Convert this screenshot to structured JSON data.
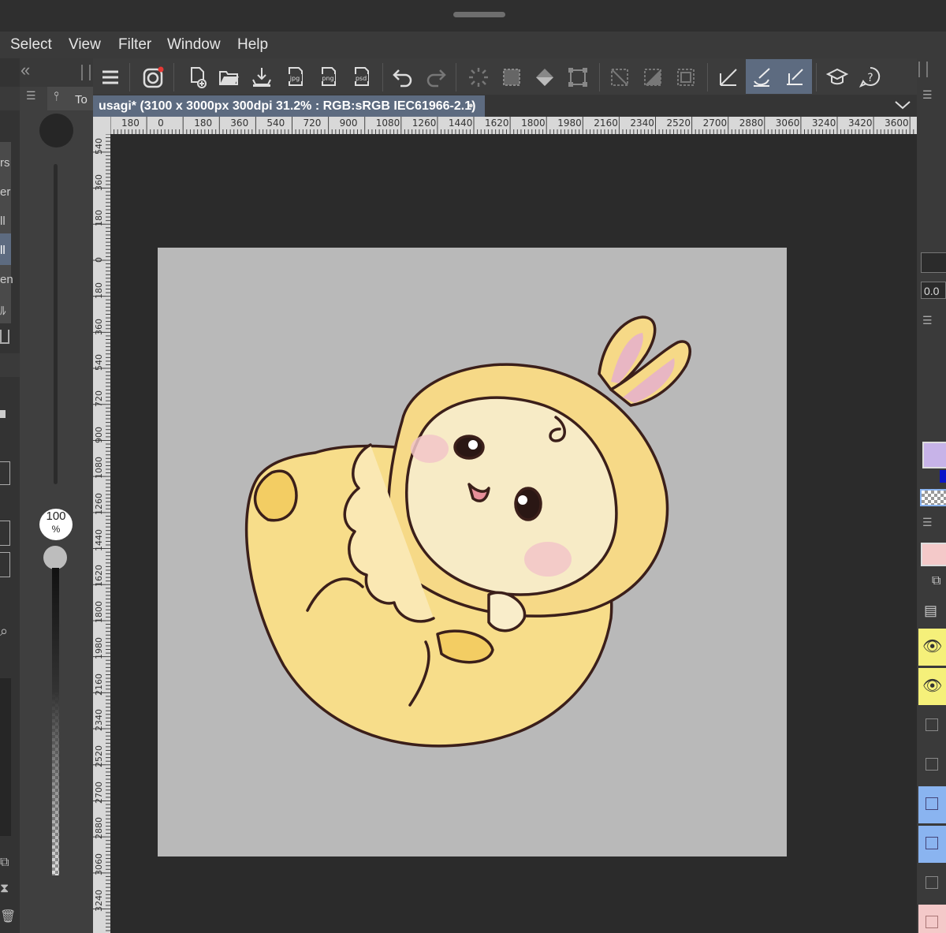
{
  "menu": {
    "items": [
      "Select",
      "View",
      "Filter",
      "Window",
      "Help"
    ]
  },
  "left_panel": {
    "collapse_glyph": "«",
    "tool_tab_label": "To",
    "sub_tool_fragments": [
      "rs",
      "er",
      "ll",
      "ll",
      "en",
      "ﾙ"
    ],
    "brush_opacity": "100",
    "brush_opacity_unit": "%"
  },
  "document": {
    "tab_title": "usagi* (3100 x 3000px 300dpi 31.2% : RGB:sRGB IEC61966-2.1)",
    "modified_dot": "●"
  },
  "rulers": {
    "horizontal": [
      "180",
      "0",
      "180",
      "360",
      "540",
      "720",
      "900",
      "1080",
      "1260",
      "1440",
      "1620",
      "1800",
      "1980",
      "2160",
      "2340",
      "2520",
      "2700",
      "2880",
      "3060",
      "3240",
      "3420",
      "3600"
    ],
    "vertical": [
      "540",
      "360",
      "180",
      "0",
      "180",
      "360",
      "540",
      "720",
      "900",
      "1080",
      "1260",
      "1440",
      "1620",
      "1800",
      "1980",
      "2160",
      "2340",
      "2520",
      "2700",
      "2880",
      "3060",
      "3240"
    ]
  },
  "right_panel": {
    "value_field": "0.0",
    "main_color": "#c7b3e8",
    "sub_color": "#0a14c8",
    "layer_colors": [
      "#f5f07a",
      "#f5f07a",
      "#3a3a3a",
      "#3a3a3a",
      "#8ab4f0",
      "#8ab4f0",
      "#3a3a3a",
      "#f4c9c9"
    ]
  },
  "canvas": {
    "paper_color": "#b9b9b9",
    "background_color": "#2b2b2b"
  },
  "icons": [
    "menu-icon",
    "hamburger-icon",
    "new-file-icon",
    "open-folder-icon",
    "import-icon",
    "export-jpg-icon",
    "export-png-icon",
    "export-psd-icon",
    "undo-icon",
    "redo-icon",
    "selection-icon",
    "eye-icon",
    "trash-icon"
  ],
  "export_labels": {
    "jpg": "jpg",
    "png": "png",
    "psd": "psd"
  }
}
